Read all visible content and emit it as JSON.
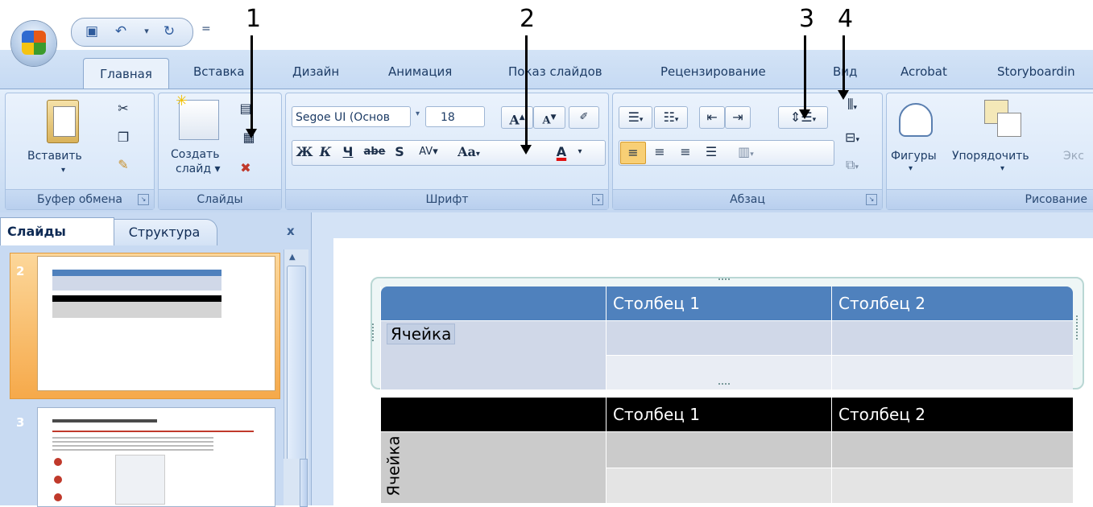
{
  "annotations": [
    "1",
    "2",
    "3",
    "4"
  ],
  "quick_access": {
    "save_icon": "save-icon",
    "undo_icon": "undo-icon",
    "redo_icon": "redo-icon",
    "more": "="
  },
  "tabs": [
    "Главная",
    "Вставка",
    "Дизайн",
    "Анимация",
    "Показ слайдов",
    "Рецензирование",
    "Вид",
    "Acrobat",
    "Storyboardin"
  ],
  "ribbon": {
    "clipboard": {
      "paste": "Вставить",
      "label": "Буфер обмена"
    },
    "slides": {
      "create": "Создать",
      "create2": "слайд ▾",
      "label": "Слайды"
    },
    "font": {
      "name": "Segoe UI (Основ",
      "size": "18",
      "bold": "Ж",
      "italic": "К",
      "underline": "Ч",
      "strike": "abe",
      "shadow": "S",
      "spacing": "AV",
      "case": "Aa",
      "color": "A",
      "grow": "A",
      "shrink": "A",
      "label": "Шрифт"
    },
    "paragraph": {
      "label": "Абзац"
    },
    "drawing": {
      "shapes": "Фигуры",
      "arrange": "Упорядочить",
      "express": "Экс",
      "label": "Рисование"
    }
  },
  "panel": {
    "tab_slides": "Слайды",
    "tab_outline": "Структура",
    "close": "x",
    "slide2": "2",
    "slide3": "3"
  },
  "table1": {
    "header": [
      "",
      "Столбец 1",
      "Столбец 2"
    ],
    "cell": "Ячейка"
  },
  "table2": {
    "header": [
      "",
      "Столбец 1",
      "Столбец 2"
    ],
    "cell": "Ячейка"
  }
}
